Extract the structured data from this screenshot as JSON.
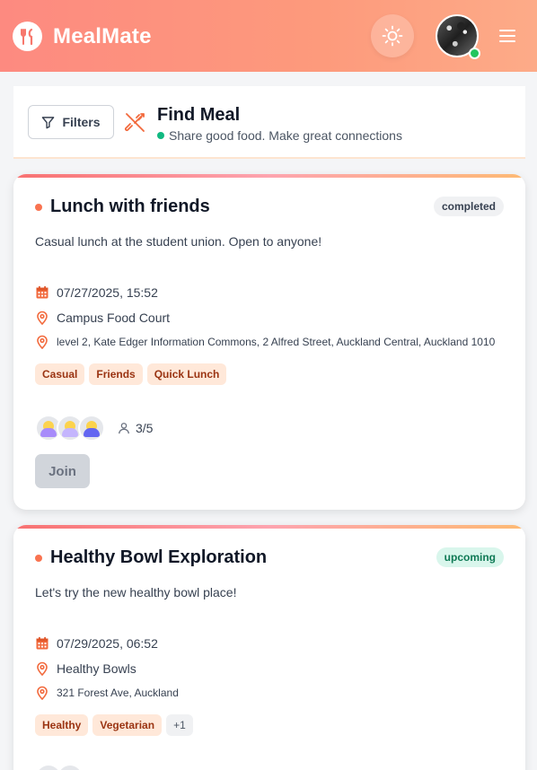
{
  "app": {
    "name": "MealMate"
  },
  "header": {
    "theme_icon": "sun-icon",
    "menu_icon": "hamburger-icon",
    "avatar_status": "online"
  },
  "findbar": {
    "filters_label": "Filters",
    "title": "Find Meal",
    "subtitle": "Share good food. Make great connections"
  },
  "colors": {
    "brand_from": "#fd8a80",
    "brand_to": "#fdab88",
    "accent": "#f97350",
    "online": "#22c55e"
  },
  "meals": [
    {
      "title": "Lunch with friends",
      "status": "completed",
      "description": "Casual lunch at the student union. Open to anyone!",
      "datetime": "07/27/2025, 15:52",
      "venue": "Campus Food Court",
      "address": "level 2, Kate Edger Information Commons, 2 Alfred Street, Auckland Central, Auckland 1010",
      "tags": [
        "Casual",
        "Friends",
        "Quick Lunch"
      ],
      "participants": "3/5",
      "join_label": "Join"
    },
    {
      "title": "Healthy Bowl Exploration",
      "status": "upcoming",
      "description": "Let's try the new healthy bowl place!",
      "datetime": "07/29/2025, 06:52",
      "venue": "Healthy Bowls",
      "address": "321 Forest Ave, Auckland",
      "tags": [
        "Healthy",
        "Vegetarian"
      ],
      "more_tags": "+1"
    }
  ]
}
